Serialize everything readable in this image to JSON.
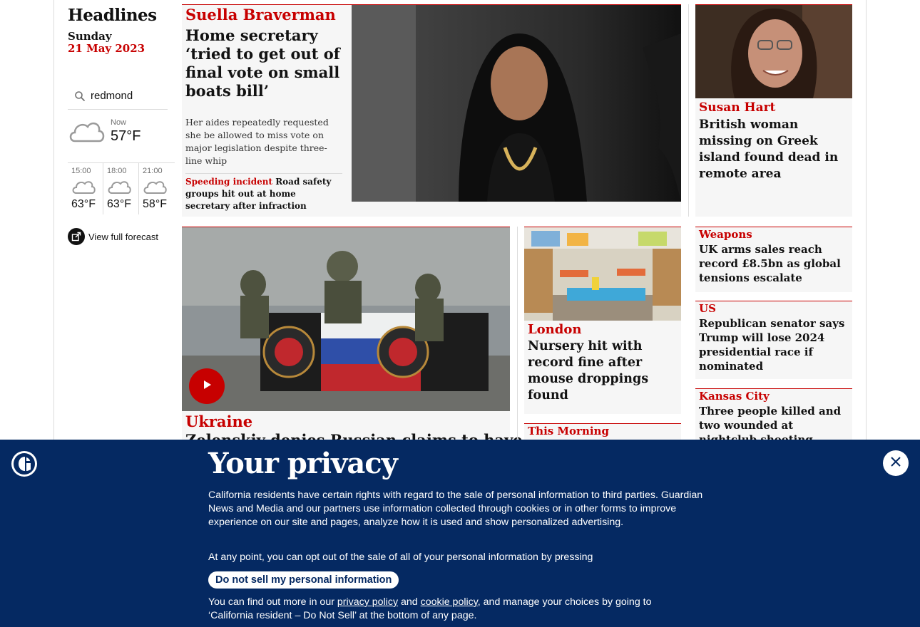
{
  "sidebar": {
    "title": "Headlines",
    "day": "Sunday",
    "date": "21 May 2023",
    "location": "redmond",
    "now_label": "Now",
    "now_temp": "57°F",
    "forecast": [
      {
        "time": "15:00",
        "temp": "63°F"
      },
      {
        "time": "18:00",
        "temp": "63°F"
      },
      {
        "time": "21:00",
        "temp": "58°F"
      }
    ],
    "full_forecast_label": "View full forecast"
  },
  "main_story": {
    "kicker": "Suella Braverman",
    "headline": "Home secretary ‘tried to get out of final vote on small boats bill’",
    "standfirst": "Her aides repeatedly requested she be allowed to miss vote on major legislation despite three-line whip",
    "sublink_kicker": "Speeding incident",
    "sublink_text": "Road safety groups hit out at home secretary after infraction"
  },
  "right_story": {
    "kicker": "Susan Hart",
    "headline": "British woman missing on Greek island found dead in remote area"
  },
  "video_story": {
    "kicker": "Ukraine",
    "headline": "Zelenskiy denies Russian claims to have"
  },
  "nursery_story": {
    "kicker": "London",
    "headline": "Nursery hit with record fine after mouse droppings found"
  },
  "this_morning": {
    "kicker": "This Morning"
  },
  "small_stories": [
    {
      "kicker": "Weapons",
      "headline": "UK arms sales reach record £8.5bn as global tensions escalate"
    },
    {
      "kicker": "US",
      "headline": "Republican senator says Trump will lose 2024 presidential race if nominated"
    },
    {
      "kicker": "Kansas City",
      "headline": "Three people killed and two wounded at nightclub shooting"
    }
  ],
  "privacy": {
    "title": "Your privacy",
    "body": "California residents have certain rights with regard to the sale of personal information to third parties. Guardian News and Media and our partners use information collected through cookies or in other forms to improve experience on our site and pages, analyze how it is used and show personalized advertising.",
    "body2": "At any point, you can opt out of the sale of all of your personal information by pressing",
    "button": "Do not sell my personal information",
    "body3_pre": "You can find out more in our ",
    "privacy_link": "privacy policy",
    "body3_and": " and ",
    "cookie_link": "cookie policy",
    "body3_post": ", and manage your choices by going to ‘California resident – Do Not Sell’ at the bottom of any page."
  },
  "colors": {
    "accent": "#c70000",
    "banner": "#052962"
  }
}
